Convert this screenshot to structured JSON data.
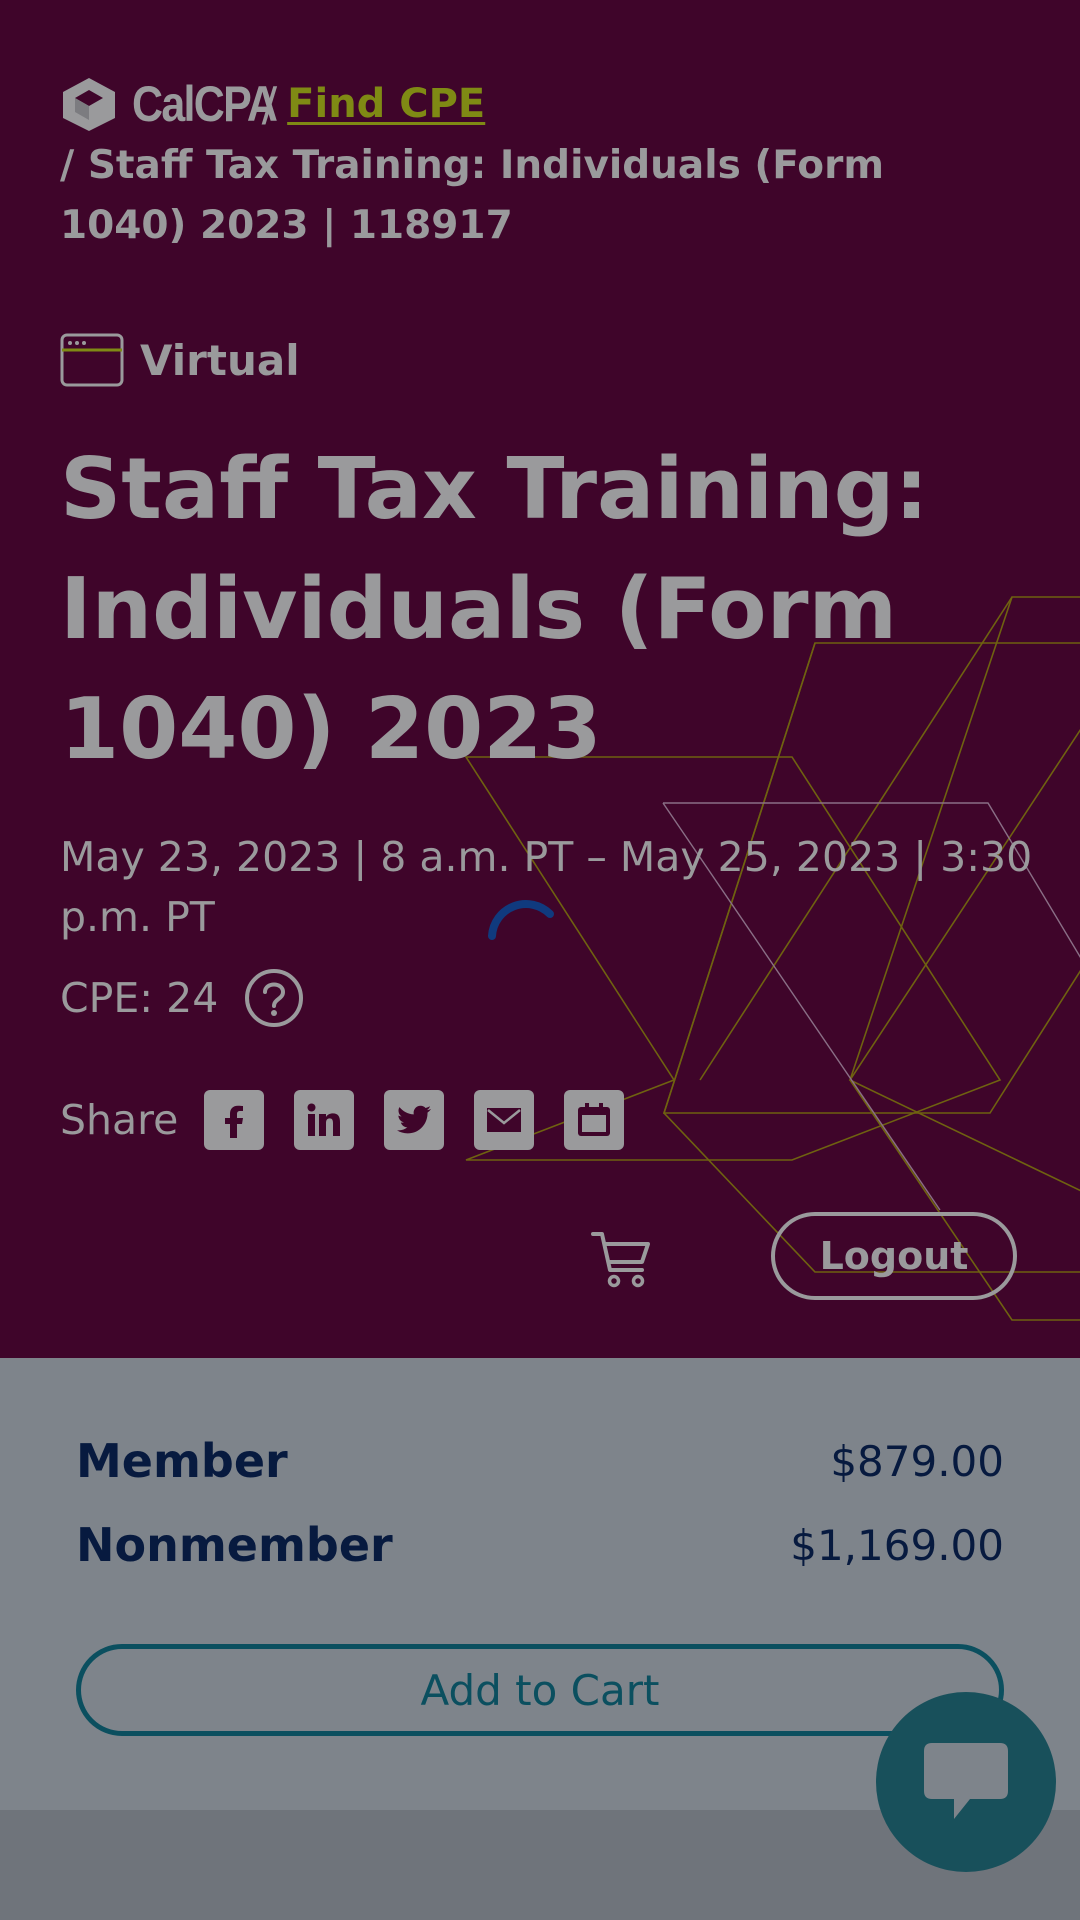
{
  "header": {
    "brand": "CalCPA",
    "brand_separator": "/",
    "breadcrumb_link": "Find CPE",
    "breadcrumb_trail": "/ Staff Tax Training: Individuals (Form 1040) 2023 | 118917"
  },
  "course": {
    "format": "Virtual",
    "title": "Staff Tax Training: Individuals (Form 1040) 2023",
    "dates": "May 23, 2023 | 8 a.m. PT – May 25, 2023 | 3:30 p.m. PT",
    "cpe": "CPE: 24"
  },
  "share": {
    "label": "Share",
    "buttons": [
      "facebook-icon",
      "linkedin-icon",
      "twitter-icon",
      "email-icon",
      "calendar-icon"
    ]
  },
  "account": {
    "logout_label": "Logout"
  },
  "pricing": {
    "rows": [
      {
        "label": "Member",
        "price": "$879.00"
      },
      {
        "label": "Nonmember",
        "price": "$1,169.00"
      }
    ],
    "add_to_cart_label": "Add to Cart"
  },
  "colors": {
    "hero_bg": "#3f052a",
    "accent_olive": "#7f8a14",
    "text_muted": "#9a9a9c",
    "navy": "#071a3f",
    "teal": "#0b4f5f",
    "chat_bg": "#18505b"
  }
}
